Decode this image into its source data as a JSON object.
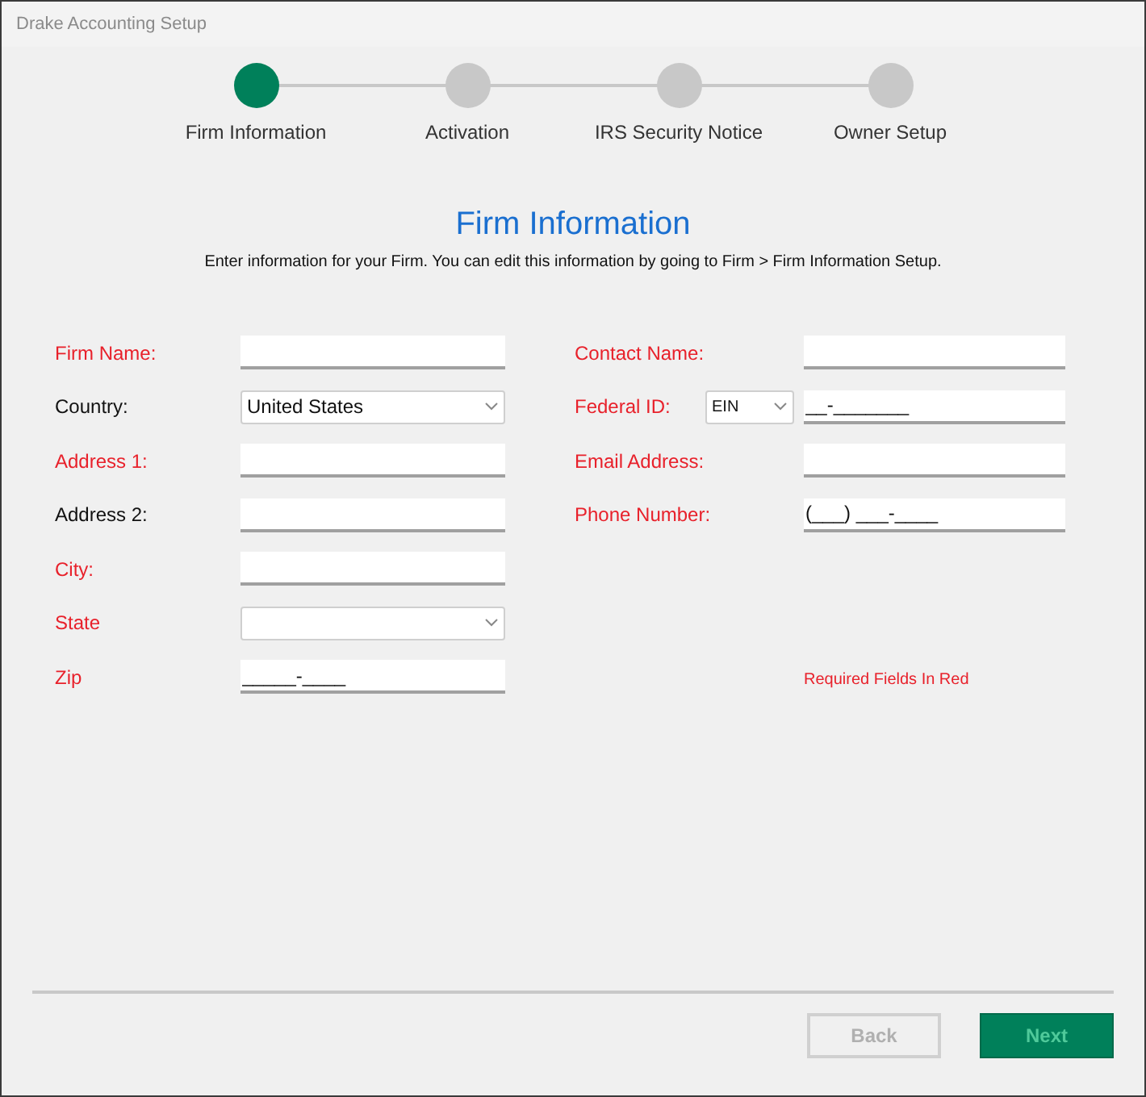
{
  "window": {
    "title": "Drake Accounting Setup"
  },
  "steps": [
    {
      "label": "Firm Information",
      "selected": true
    },
    {
      "label": "Activation",
      "selected": false
    },
    {
      "label": "IRS Security Notice",
      "selected": false
    },
    {
      "label": "Owner Setup",
      "selected": false
    }
  ],
  "heading": "Firm Information",
  "subtitle": "Enter information for your Firm. You can edit this information by going to Firm > Firm Information Setup.",
  "left_fields": [
    {
      "label": "Firm Name:",
      "required": true,
      "kind": "text"
    },
    {
      "label": "Country:",
      "required": false,
      "kind": "dropdown",
      "value": "United States"
    },
    {
      "label": "Address 1:",
      "required": true,
      "kind": "text"
    },
    {
      "label": "Address 2:",
      "required": false,
      "kind": "text"
    },
    {
      "label": "City:",
      "required": true,
      "kind": "text"
    },
    {
      "label": "State",
      "required": true,
      "kind": "dropdown"
    },
    {
      "label": "Zip",
      "required": true,
      "kind": "text",
      "value": "_____-____"
    }
  ],
  "right_fields": [
    {
      "label": "Contact Name:",
      "required": true,
      "kind": "text"
    },
    {
      "label": "Federal ID:",
      "required": true,
      "kind": "id",
      "type_value": "EIN",
      "value": "__-_______"
    },
    {
      "label": "Email Address:",
      "required": true,
      "kind": "text"
    },
    {
      "label": "Phone Number:",
      "required": true,
      "kind": "text",
      "value": "(___) ___-____"
    }
  ],
  "required_note": "Required Fields In Red",
  "buttons": [
    {
      "label": "Back",
      "kind": "secondary",
      "disabled": true
    },
    {
      "label": "Next",
      "kind": "primary",
      "disabled": false
    }
  ]
}
